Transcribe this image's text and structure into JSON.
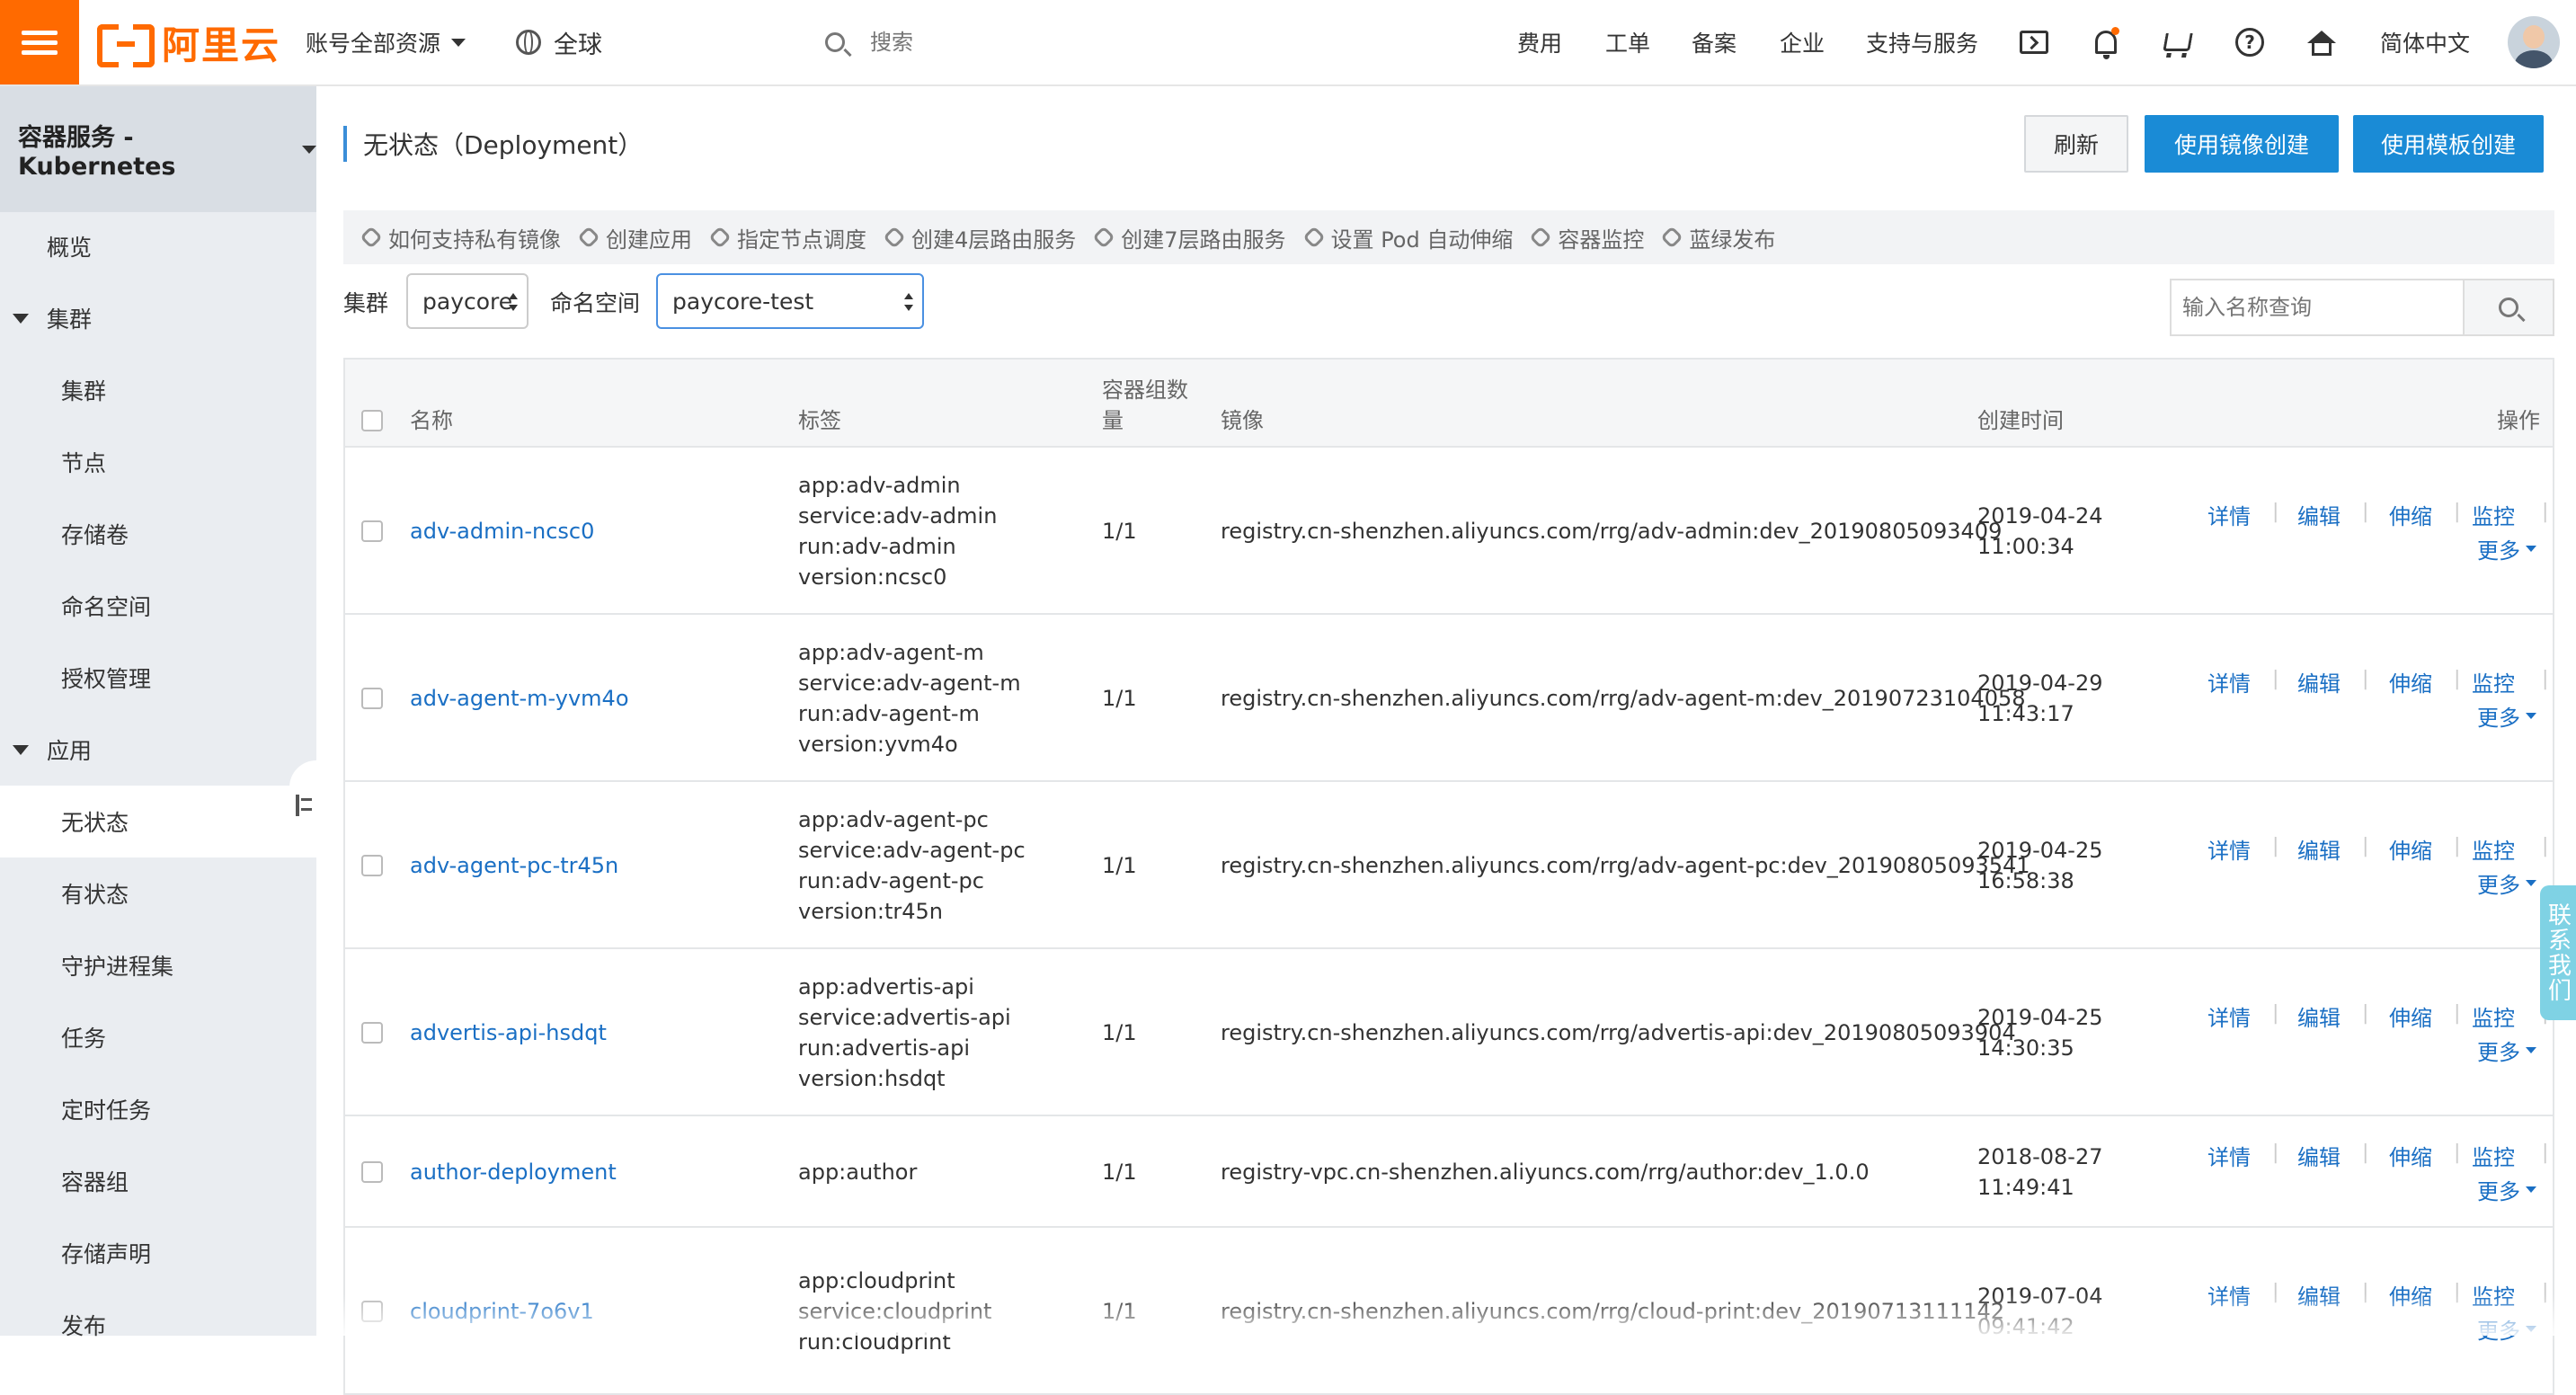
{
  "topbar": {
    "logo_text": "阿里云",
    "resources_label": "账号全部资源",
    "region_label": "全球",
    "search_placeholder": "搜索",
    "nav": [
      "费用",
      "工单",
      "备案",
      "企业",
      "支持与服务"
    ],
    "language": "简体中文",
    "accent_color": "#ff6a00"
  },
  "sidebar": {
    "product_title": "容器服务 - Kubernetes",
    "overview": "概览",
    "group_cluster": "集群",
    "cluster_items": [
      "集群",
      "节点",
      "存储卷",
      "命名空间",
      "授权管理"
    ],
    "group_app": "应用",
    "app_items": [
      "无状态",
      "有状态",
      "守护进程集",
      "任务",
      "定时任务",
      "容器组",
      "存储声明",
      "发布"
    ]
  },
  "main": {
    "title": "无状态（Deployment）",
    "refresh_label": "刷新",
    "create_image_label": "使用镜像创建",
    "create_template_label": "使用模板创建",
    "help_links": [
      "如何支持私有镜像",
      "创建应用",
      "指定节点调度",
      "创建4层路由服务",
      "创建7层路由服务",
      "设置 Pod 自动伸缩",
      "容器监控",
      "蓝绿发布"
    ],
    "cluster_label": "集群",
    "cluster_value": "paycore",
    "namespace_label": "命名空间",
    "namespace_value": "paycore-test",
    "name_search_placeholder": "输入名称查询"
  },
  "table": {
    "headers": {
      "name": "名称",
      "labels": "标签",
      "pods_line1": "容器组数",
      "pods_line2": "量",
      "image": "镜像",
      "created": "创建时间",
      "actions": "操作"
    },
    "actions": [
      "详情",
      "编辑",
      "伸缩",
      "监控"
    ],
    "more_label": "更多",
    "rows": [
      {
        "name": "adv-admin-ncsc0",
        "labels": [
          "app:adv-admin",
          "service:adv-admin",
          "run:adv-admin",
          "version:ncsc0"
        ],
        "pods": "1/1",
        "image": "registry.cn-shenzhen.aliyuncs.com/rrg/adv-admin:dev_20190805093409",
        "created_date": "2019-04-24",
        "created_time": "11:00:34"
      },
      {
        "name": "adv-agent-m-yvm4o",
        "labels": [
          "app:adv-agent-m",
          "service:adv-agent-m",
          "run:adv-agent-m",
          "version:yvm4o"
        ],
        "pods": "1/1",
        "image": "registry.cn-shenzhen.aliyuncs.com/rrg/adv-agent-m:dev_20190723104058",
        "created_date": "2019-04-29",
        "created_time": "11:43:17"
      },
      {
        "name": "adv-agent-pc-tr45n",
        "labels": [
          "app:adv-agent-pc",
          "service:adv-agent-pc",
          "run:adv-agent-pc",
          "version:tr45n"
        ],
        "pods": "1/1",
        "image": "registry.cn-shenzhen.aliyuncs.com/rrg/adv-agent-pc:dev_20190805093541",
        "created_date": "2019-04-25",
        "created_time": "16:58:38"
      },
      {
        "name": "advertis-api-hsdqt",
        "labels": [
          "app:advertis-api",
          "service:advertis-api",
          "run:advertis-api",
          "version:hsdqt"
        ],
        "pods": "1/1",
        "image": "registry.cn-shenzhen.aliyuncs.com/rrg/advertis-api:dev_20190805093904",
        "created_date": "2019-04-25",
        "created_time": "14:30:35"
      },
      {
        "name": "author-deployment",
        "labels": [
          "app:author"
        ],
        "pods": "1/1",
        "image": "registry-vpc.cn-shenzhen.aliyuncs.com/rrg/author:dev_1.0.0",
        "created_date": "2018-08-27",
        "created_time": "11:49:41"
      },
      {
        "name": "cloudprint-7o6v1",
        "labels": [
          "app:cloudprint",
          "service:cloudprint",
          "run:cloudprint"
        ],
        "pods": "1/1",
        "image": "registry.cn-shenzhen.aliyuncs.com/rrg/cloud-print:dev_20190713111142",
        "created_date": "2019-07-04",
        "created_time": "09:41:42"
      }
    ]
  },
  "contact_label": "联系我们"
}
